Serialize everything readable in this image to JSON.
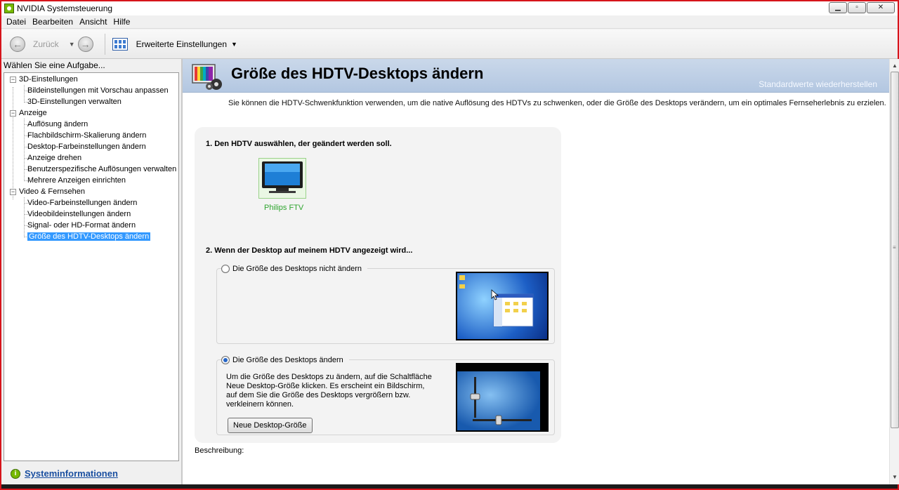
{
  "window": {
    "title": "NVIDIA Systemsteuerung",
    "controls": [
      "▁",
      "▫",
      "✕"
    ]
  },
  "menu": [
    "Datei",
    "Bearbeiten",
    "Ansicht",
    "Hilfe"
  ],
  "toolbar": {
    "back_label": "Zurück",
    "advanced_label": "Erweiterte Einstellungen"
  },
  "sidebar": {
    "header": "Wählen Sie eine Aufgabe...",
    "groups": [
      {
        "label": "3D-Einstellungen",
        "items": [
          "Bildeinstellungen mit Vorschau anpassen",
          "3D-Einstellungen verwalten"
        ]
      },
      {
        "label": "Anzeige",
        "items": [
          "Auflösung ändern",
          "Flachbildschirm-Skalierung ändern",
          "Desktop-Farbeinstellungen ändern",
          "Anzeige drehen",
          "Benutzerspezifische Auflösungen verwalten",
          "Mehrere Anzeigen einrichten"
        ]
      },
      {
        "label": "Video & Fernsehen",
        "items": [
          "Video-Farbeinstellungen ändern",
          "Videobildeinstellungen ändern",
          "Signal- oder HD-Format ändern",
          "Größe des HDTV-Desktops ändern"
        ]
      }
    ],
    "selected": "Größe des HDTV-Desktops ändern",
    "system_info": "Systeminformationen"
  },
  "page": {
    "title": "Größe des HDTV-Desktops ändern",
    "restore_defaults": "Standardwerte wiederherstellen",
    "intro": "Sie können die HDTV-Schwenkfunktion verwenden, um die native Auflösung des HDTVs zu schwenken, oder die Größe des Desktops verändern, um ein optimales Fernseherlebnis zu erzielen.",
    "step1": "1. Den HDTV auswählen, der geändert werden soll.",
    "tv_name": "Philips FTV",
    "step2": "2. Wenn der Desktop auf meinem HDTV angezeigt wird...",
    "option1": "Die Größe des Desktops nicht ändern",
    "option2": "Die Größe des Desktops ändern",
    "option2_desc": "Um die Größe des Desktops zu ändern, auf die Schaltfläche Neue Desktop-Größe klicken.  Es erscheint ein Bildschirm, auf dem Sie die Größe des Desktops vergrößern bzw. verkleinern können.",
    "new_size_button": "Neue Desktop-Größe",
    "description_label": "Beschreibung:",
    "selected_option": 2
  },
  "colors": {
    "frame": "#d6141b",
    "banner": "#b3c7e1",
    "nvidia_green": "#76b900",
    "selection": "#3399ff",
    "tv_label": "#2fa52f"
  }
}
